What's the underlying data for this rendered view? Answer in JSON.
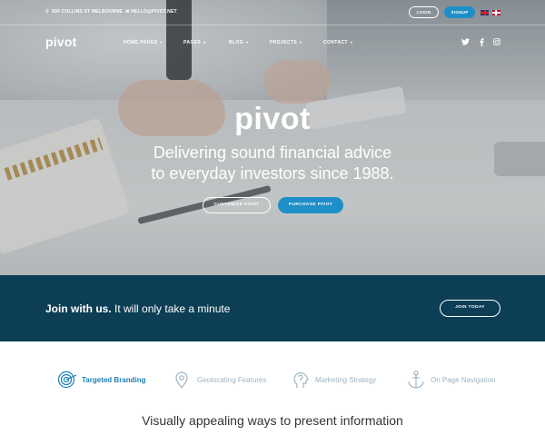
{
  "topbar": {
    "address": " 500 COLLINS ST MELBOURNE",
    "email": "HELLO@PIVOT.NET",
    "login_label": "LOGIN",
    "signup_label": "SIGNUP",
    "languages": [
      "uk-flag",
      "dk-flag"
    ]
  },
  "header": {
    "logo": "pivot",
    "nav": [
      {
        "label": "HOME PAGES"
      },
      {
        "label": "PAGES"
      },
      {
        "label": "BLOG"
      },
      {
        "label": "PROJECTS"
      },
      {
        "label": "CONTACT"
      }
    ],
    "social": [
      "twitter-icon",
      "facebook-icon",
      "instagram-icon"
    ]
  },
  "hero": {
    "title": "pivot",
    "subtitle_line1": "Delivering sound financial advice",
    "subtitle_line2": "to everyday investors since 1988.",
    "customize_label": "CUSTOMIZE PIVOT",
    "purchase_label": "PURCHASE PIVOT"
  },
  "cta": {
    "bold": "Join with us.",
    "rest": "It will only take a minute",
    "button_label": "JOIN TODAY"
  },
  "tabs": [
    {
      "label": "Targeted Branding",
      "icon": "target-icon",
      "active": true
    },
    {
      "label": "Geolocating Features",
      "icon": "location-pin-icon",
      "active": false
    },
    {
      "label": "Marketing Strategy",
      "icon": "head-profile-icon",
      "active": false
    },
    {
      "label": "On Page Navigation",
      "icon": "anchor-icon",
      "active": false
    }
  ],
  "section": {
    "title": "Visually appealing ways to present information"
  },
  "colors": {
    "accent": "#1e8fc8",
    "cta_bg": "#0c3e55",
    "tab_active": "#1e7fb8",
    "tab_inactive": "#9fb4c2"
  }
}
